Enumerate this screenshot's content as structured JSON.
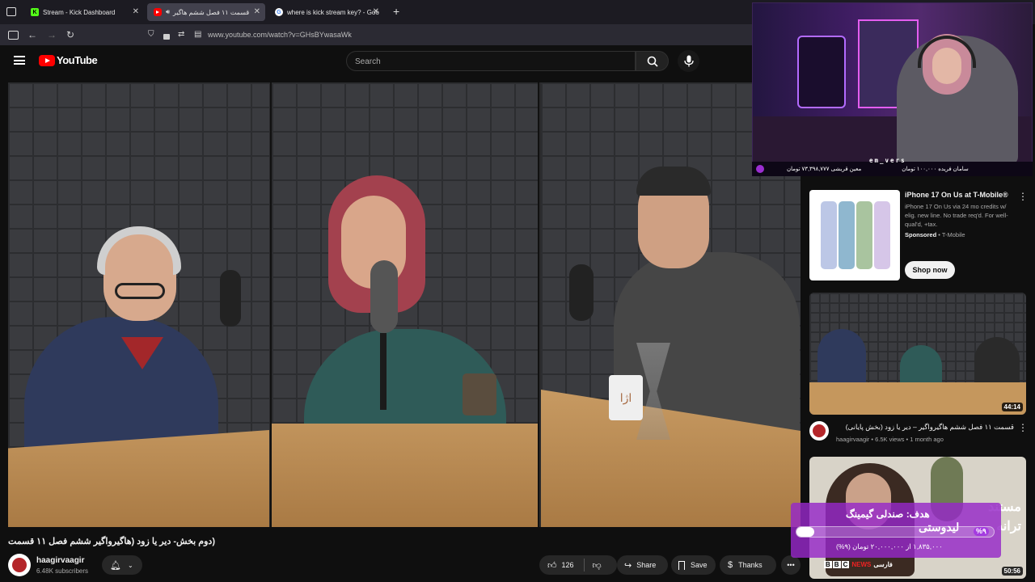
{
  "browser": {
    "tabs": [
      {
        "label": "Stream - Kick Dashboard",
        "favicon": "kick-icon"
      },
      {
        "label": "قسمت ۱۱ فصل ششم هاگیر",
        "favicon": "youtube-icon"
      },
      {
        "label": "where is kick stream key? - Goo",
        "favicon": "google-icon"
      }
    ],
    "url": "www.youtube.com/watch?v=GHsBYwasaWk"
  },
  "youtube": {
    "logo_text": "YouTube",
    "search_placeholder": "Search"
  },
  "video": {
    "title": "(دوم بخش- دیر یا زود (هاگیرواگیر  ششم فصل ۱۱ قسمت",
    "channel_name": "haagirvaagir",
    "subscribers": "6.48K subscribers",
    "likes": "126",
    "share_label": "Share",
    "save_label": "Save",
    "thanks_label": "Thanks",
    "mug_text": "اژا"
  },
  "sidebar": {
    "ad": {
      "title": "iPhone 17 On Us at T-Mobile®",
      "description": "iPhone 17 On Us via 24 mo credits w/ elig. new line. No trade req'd. For well-qual'd, +tax.",
      "sponsored_label": "Sponsored",
      "sponsor": "T-Mobile",
      "button": "Shop now"
    },
    "recommendations": [
      {
        "title": "قسمت ۱۱ فصل ششم هاگیرواگیر – دیر یا زود (بخش پایانی)",
        "channel": "haagirvaagir",
        "views": "6.5K views",
        "age": "1 month ago",
        "duration": "44:14"
      },
      {
        "thumb_text_1": "مستند",
        "thumb_text_2": "ترانه",
        "bbc_b1": "B",
        "bbc_b2": "B",
        "bbc_c": "C",
        "news": "NEWS",
        "persian": "فارسی",
        "duration": "50:56"
      }
    ]
  },
  "stream_overlay": {
    "streamer": "em_vers",
    "donation_1": "سامان فریده ۱۰۰,۰۰۰ تومان",
    "donation_2": "معین قریشی ۷۳,۳۹۸,۷۷۷ تومان",
    "goal_title": "هدف: صندلی گیمینگ",
    "goal_percent_label": "%۹",
    "goal_amount": "۱,۸۳۵,۰۰۰ از ۲۰,۰۰۰,۰۰۰ تومان (۹%)",
    "goal_progress": 0.09,
    "side_text": "لیدوستی"
  },
  "colors": {
    "youtube_red": "#ff0000",
    "goal_purple": "#9628c8",
    "background": "#0f0f0f"
  }
}
